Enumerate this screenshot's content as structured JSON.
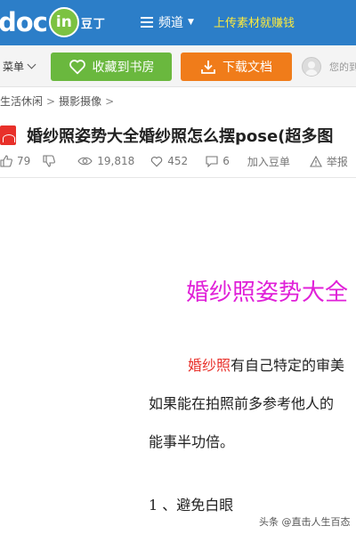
{
  "header": {
    "logo_text": "doc",
    "logo_circle": "in",
    "logo_cn": "豆丁",
    "channel_label": "频道",
    "upload_link": "上传素材就赚钱"
  },
  "toolbar": {
    "menu_label": "菜单",
    "favorite_label": "收藏到书房",
    "download_label": "下载文档",
    "user_text": "您的到"
  },
  "breadcrumb": [
    "生活休闲",
    "摄影摄像"
  ],
  "document": {
    "title": "婚纱照姿势大全婚纱照怎么摆pose(超多图",
    "stats": {
      "likes": "79",
      "views": "19,818",
      "favorites": "452",
      "comments": "6",
      "add_label": "加入豆单",
      "report_label": "举报"
    }
  },
  "content": {
    "heading": "婚纱照姿势大全",
    "para1_highlight": "婚纱照",
    "para1_rest": "有自己特定的审美",
    "para2": "如果能在拍照前多参考他人的",
    "para3": "能事半功倍。",
    "section1": "1 、避免白眼"
  },
  "watermark": "头条 @直击人生百态",
  "colors": {
    "header_bg": "#2c7ec8",
    "favorite_bg": "#6ab83e",
    "download_bg": "#f07c1a",
    "heading_color": "#e020d8",
    "highlight_color": "#e8302a"
  }
}
